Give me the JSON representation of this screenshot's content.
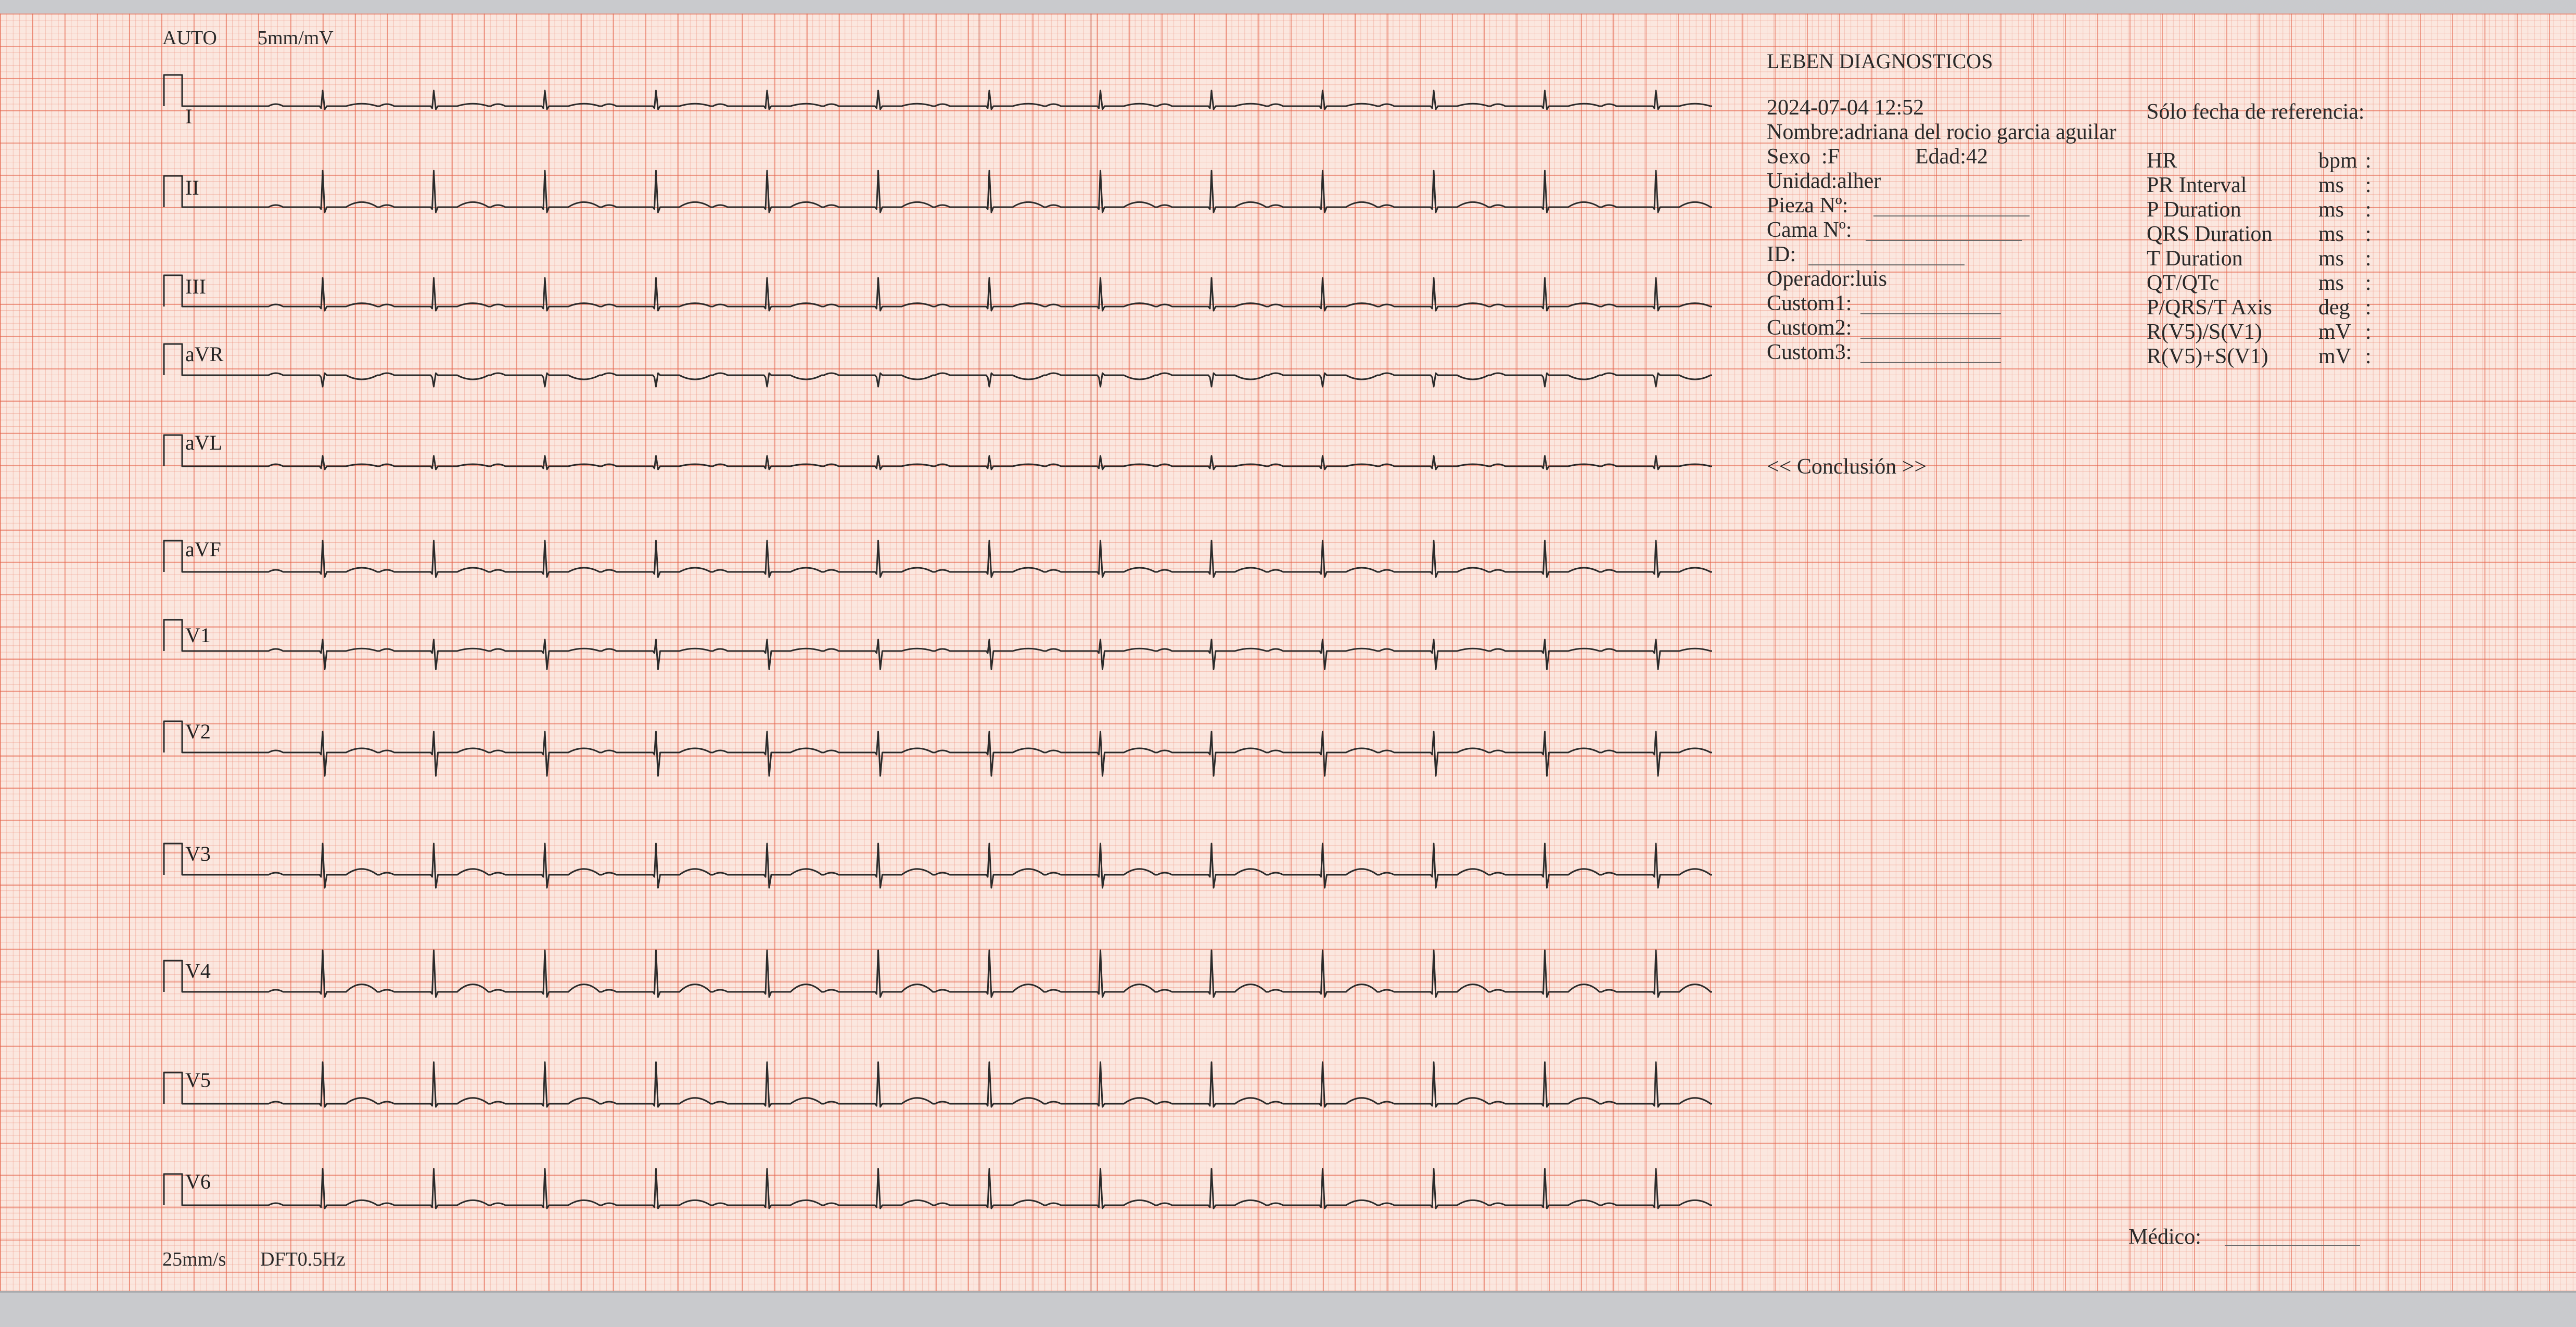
{
  "header": {
    "mode": "AUTO",
    "gain": "5mm/mV",
    "footer_speed": "25mm/s",
    "footer_filter": "DFT0.5Hz"
  },
  "leads": [
    "I",
    "II",
    "III",
    "aVR",
    "aVL",
    "aVF",
    "V1",
    "V2",
    "V3",
    "V4",
    "V5",
    "V6"
  ],
  "institution": "LEBEN DIAGNOSTICOS",
  "patient": {
    "datetime": "2024-07-04 12:52",
    "name_line": "Nombre:adriana del rocio garcia aguilar",
    "sexo_label": "Sexo  :F",
    "edad_label": "Edad:42",
    "unidad": "Unidad:alher",
    "pieza": "Pieza Nº:",
    "cama": "Cama Nº:",
    "id": "ID:",
    "operador": "Operador:luis",
    "custom1": "Custom1:",
    "custom2": "Custom2:",
    "custom3": "Custom3:"
  },
  "reference_note": "Sólo fecha de referencia:",
  "measurements": [
    {
      "label": "HR",
      "unit": "bpm",
      "value": ":"
    },
    {
      "label": "PR Interval",
      "unit": "ms",
      "value": ":"
    },
    {
      "label": "P Duration",
      "unit": "ms",
      "value": ":"
    },
    {
      "label": "QRS Duration",
      "unit": "ms",
      "value": ":"
    },
    {
      "label": "T Duration",
      "unit": "ms",
      "value": ":"
    },
    {
      "label": "QT/QTc",
      "unit": "ms",
      "value": ":"
    },
    {
      "label": "P/QRS/T Axis",
      "unit": "deg",
      "value": ":"
    },
    {
      "label": "R(V5)/S(V1)",
      "unit": "mV",
      "value": ":"
    },
    {
      "label": "R(V5)+S(V1)",
      "unit": "mV",
      "value": ":"
    }
  ],
  "conclusion_label": "<< Conclusión >>",
  "medico_label": "Médico:",
  "colors": {
    "paper": "#fbe7df",
    "grid_major": "#e46046",
    "grid_minor": "#ec8c78",
    "trace": "#2b2b2b"
  }
}
